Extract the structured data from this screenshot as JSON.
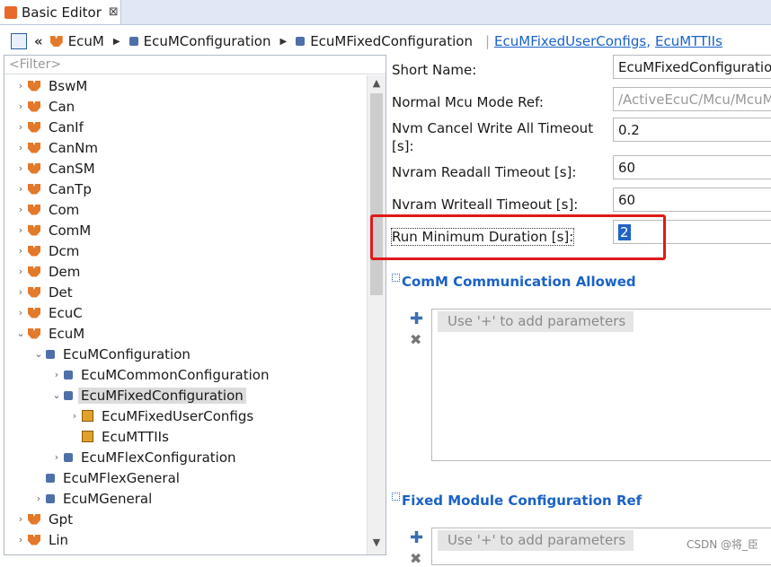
{
  "tab": {
    "title": "Basic Editor",
    "close": "⊠"
  },
  "breadcrumb": {
    "back": "«",
    "items": [
      "EcuM",
      "EcuMConfiguration",
      "EcuMFixedConfiguration"
    ],
    "links": [
      "EcuMFixedUserConfigs",
      "EcuMTTIIs"
    ],
    "link_sep": ","
  },
  "filter_placeholder": "<Filter>",
  "tree": [
    {
      "label": "BswM",
      "chev": "›",
      "icon": "orange"
    },
    {
      "label": "Can",
      "chev": "›",
      "icon": "orange"
    },
    {
      "label": "CanIf",
      "chev": "›",
      "icon": "orange"
    },
    {
      "label": "CanNm",
      "chev": "›",
      "icon": "orange"
    },
    {
      "label": "CanSM",
      "chev": "›",
      "icon": "orange"
    },
    {
      "label": "CanTp",
      "chev": "›",
      "icon": "orange"
    },
    {
      "label": "Com",
      "chev": "›",
      "icon": "orange"
    },
    {
      "label": "ComM",
      "chev": "›",
      "icon": "orange"
    },
    {
      "label": "Dcm",
      "chev": "›",
      "icon": "orange"
    },
    {
      "label": "Dem",
      "chev": "›",
      "icon": "orange"
    },
    {
      "label": "Det",
      "chev": "›",
      "icon": "orange"
    },
    {
      "label": "EcuC",
      "chev": "›",
      "icon": "orange"
    },
    {
      "label": "EcuM",
      "chev": "⌄",
      "icon": "orange"
    },
    {
      "label": "EcuMConfiguration",
      "chev": "⌄",
      "icon": "cube",
      "indent": 1
    },
    {
      "label": "EcuMCommonConfiguration",
      "chev": "›",
      "icon": "cube",
      "indent": 2
    },
    {
      "label": "EcuMFixedConfiguration",
      "chev": "⌄",
      "icon": "cube",
      "indent": 2,
      "selected": true
    },
    {
      "label": "EcuMFixedUserConfigs",
      "chev": "›",
      "icon": "ycube",
      "indent": 3
    },
    {
      "label": "EcuMTTIIs",
      "chev": "",
      "icon": "ycube",
      "indent": 3
    },
    {
      "label": "EcuMFlexConfiguration",
      "chev": "›",
      "icon": "cube",
      "indent": 2
    },
    {
      "label": "EcuMFlexGeneral",
      "chev": "",
      "icon": "cube",
      "indent": 1
    },
    {
      "label": "EcuMGeneral",
      "chev": "›",
      "icon": "cube",
      "indent": 1
    },
    {
      "label": "Gpt",
      "chev": "›",
      "icon": "orange"
    },
    {
      "label": "Lin",
      "chev": "›",
      "icon": "orange"
    }
  ],
  "fields": [
    {
      "label": "Short Name:",
      "value": "EcuMFixedConfiguration"
    },
    {
      "label": "Normal Mcu Mode Ref:",
      "value": "/ActiveEcuC/Mcu/McuM",
      "disabled": true
    },
    {
      "label": "Nvm Cancel Write All Timeout [s]:",
      "value": "0.2"
    },
    {
      "label": "Nvram Readall Timeout [s]:",
      "value": "60"
    },
    {
      "label": "Nvram Writeall Timeout [s]:",
      "value": "60"
    },
    {
      "label": "Run Minimum Duration [s]:",
      "value": "2",
      "focused": true
    }
  ],
  "sections": [
    {
      "title": "ComM Communication Allowed",
      "hint": "Use '+' to add parameters"
    },
    {
      "title": "Fixed Module Configuration Ref",
      "hint": "Use '+' to add parameters"
    }
  ],
  "watermark": "CSDN @将_臣",
  "colors": {
    "link": "#1a62c7",
    "highlight": "#e01a1a",
    "selection": "#1f63c6"
  }
}
